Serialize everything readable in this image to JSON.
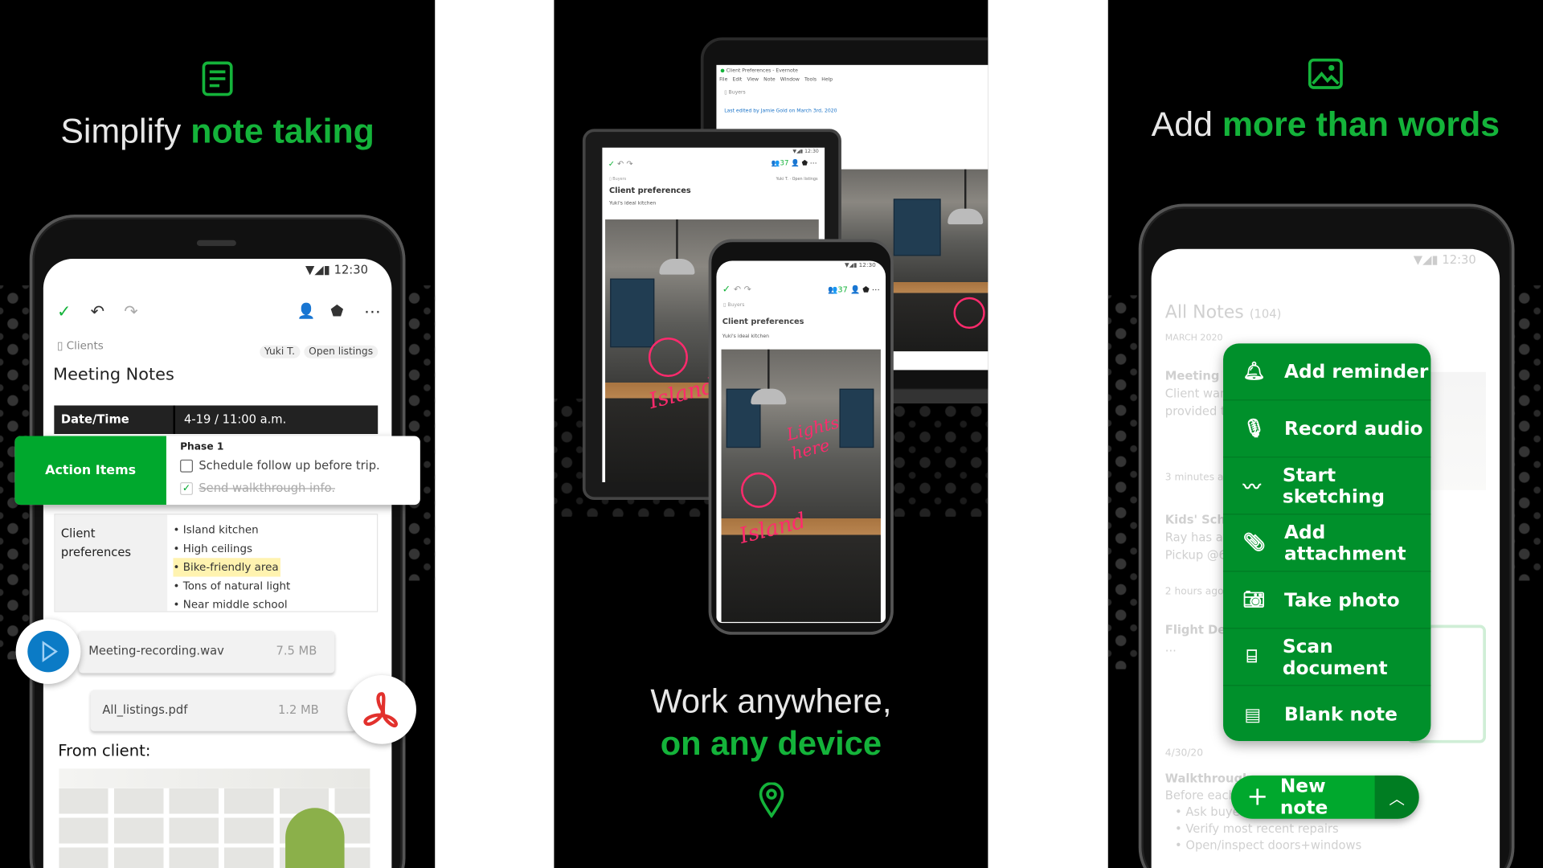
{
  "colors": {
    "brand_green": "#00a82d",
    "menu_green": "#00902b",
    "highlight": "#fff3b0",
    "annotation": "#ff2a6d",
    "play_blue": "#0b7bc6",
    "pdf_red": "#e2312d"
  },
  "panel1": {
    "icon": "note-icon",
    "headline": {
      "plain": "Simplify ",
      "accent": "note taking"
    },
    "status_time": "12:30",
    "breadcrumb": "Clients",
    "tags": [
      "Yuki T.",
      "Open listings"
    ],
    "note_title": "Meeting Notes",
    "table": {
      "row1": {
        "label": "Date/Time",
        "value": "4-19 / 11:00 a.m."
      },
      "action": {
        "label": "Action Items",
        "phase": "Phase 1",
        "todo": [
          {
            "text": "Schedule follow up before trip.",
            "checked": false
          },
          {
            "text": "Send walkthrough info.",
            "checked": true
          }
        ]
      },
      "prefs": {
        "label": "Client preferences",
        "items": [
          "Island kitchen",
          "High ceilings",
          "Bike-friendly area",
          "Tons of natural light",
          "Near middle school"
        ],
        "highlighted": "Bike-friendly area"
      }
    },
    "attachments": [
      {
        "name": "Meeting-recording.wav",
        "size": "7.5 MB",
        "icon": "play-icon"
      },
      {
        "name": "All_listings.pdf",
        "size": "1.2 MB",
        "icon": "pdf-icon"
      }
    ],
    "from_client": "From client:"
  },
  "panel2": {
    "laptop": {
      "title": "Client Preferences - Evernote",
      "menu": [
        "File",
        "Edit",
        "View",
        "Note",
        "Window",
        "Tools",
        "Help"
      ],
      "notebook": "Buyers",
      "last_edited": "Last edited by Jamie Gold on March 3rd, 2020"
    },
    "tablet": {
      "time": "12:30",
      "share_count": "37",
      "notebook": "Buyers",
      "tags": [
        "Yuki T.",
        "Open listings"
      ],
      "title": "Client preferences",
      "subtitle": "Yuki's ideal kitchen"
    },
    "phone": {
      "time": "12:30",
      "share_count": "37",
      "notebook": "Buyers",
      "title": "Client preferences",
      "subtitle": "Yuki's ideal kitchen"
    },
    "annotations": [
      "Island",
      "Lights here",
      "Island"
    ],
    "headline": {
      "line1": "Work anywhere,",
      "line2": "on any device"
    },
    "icon": "location-pin-icon"
  },
  "panel3": {
    "icon": "image-icon",
    "headline": {
      "plain": "Add ",
      "accent": "more than words"
    },
    "status_time": "12:30",
    "list_title": "All Notes",
    "count": "(104)",
    "month": "MARCH 2020",
    "notes": [
      {
        "title": "Meeting N",
        "lines": [
          "Client wan",
          "provided t"
        ],
        "time": "3 minutes a"
      },
      {
        "title": "Kids' Sch",
        "lines": [
          "Ray has af",
          "Pickup @6"
        ],
        "time": "2 hours ago"
      },
      {
        "title": "Flight De",
        "lines": [
          "..."
        ],
        "time": "4/30/20"
      },
      {
        "title": "Walkthrough",
        "lines": [
          "Before each",
          "• Ask buyer",
          "• Verify most recent repairs",
          "• Open/inspect doors+windows"
        ]
      }
    ],
    "menu": [
      {
        "label": "Add reminder",
        "icon": "bell-icon"
      },
      {
        "label": "Record audio",
        "icon": "microphone-icon"
      },
      {
        "label": "Start sketching",
        "icon": "sketch-icon"
      },
      {
        "label": "Add attachment",
        "icon": "paperclip-icon"
      },
      {
        "label": "Take photo",
        "icon": "camera-icon"
      },
      {
        "label": "Scan document",
        "icon": "scan-icon"
      },
      {
        "label": "Blank note",
        "icon": "blank-note-icon"
      }
    ],
    "new_note": "New note"
  }
}
